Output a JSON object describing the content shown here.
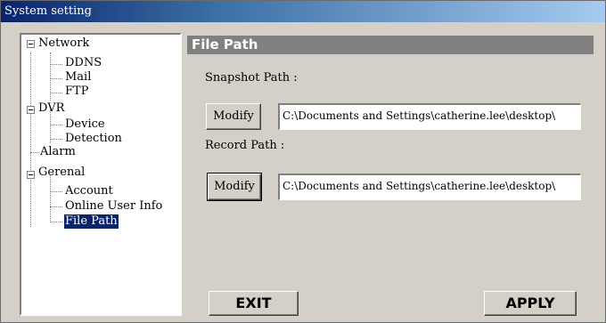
{
  "window": {
    "title": "System setting"
  },
  "tree": {
    "items": [
      {
        "label": "Network",
        "level": 0,
        "expanded": true
      },
      {
        "label": "DDNS",
        "level": 1
      },
      {
        "label": "Mail",
        "level": 1
      },
      {
        "label": "FTP",
        "level": 1
      },
      {
        "label": "DVR",
        "level": 0,
        "expanded": true
      },
      {
        "label": "Device",
        "level": 1
      },
      {
        "label": "Detection",
        "level": 1
      },
      {
        "label": "Alarm",
        "level": 0
      },
      {
        "label": "Gerenal",
        "level": 0,
        "expanded": true
      },
      {
        "label": "Account",
        "level": 1
      },
      {
        "label": "Online User Info",
        "level": 1
      },
      {
        "label": "File Path",
        "level": 1,
        "selected": true
      }
    ]
  },
  "panel": {
    "title": "File Path",
    "snapshot_label": "Snapshot Path :",
    "snapshot_modify": "Modify",
    "snapshot_value": "C:\\Documents and Settings\\catherine.lee\\desktop\\",
    "record_label": "Record Path :",
    "record_modify": "Modify",
    "record_value": "C:\\Documents and Settings\\catherine.lee\\desktop\\"
  },
  "footer": {
    "exit_label": "EXIT",
    "apply_label": "APPLY"
  },
  "colors": {
    "title_gradient_start": "#0a246a",
    "header_bg": "#808080",
    "dialog_bg": "#d4d0c8",
    "selection": "#0a246a"
  }
}
